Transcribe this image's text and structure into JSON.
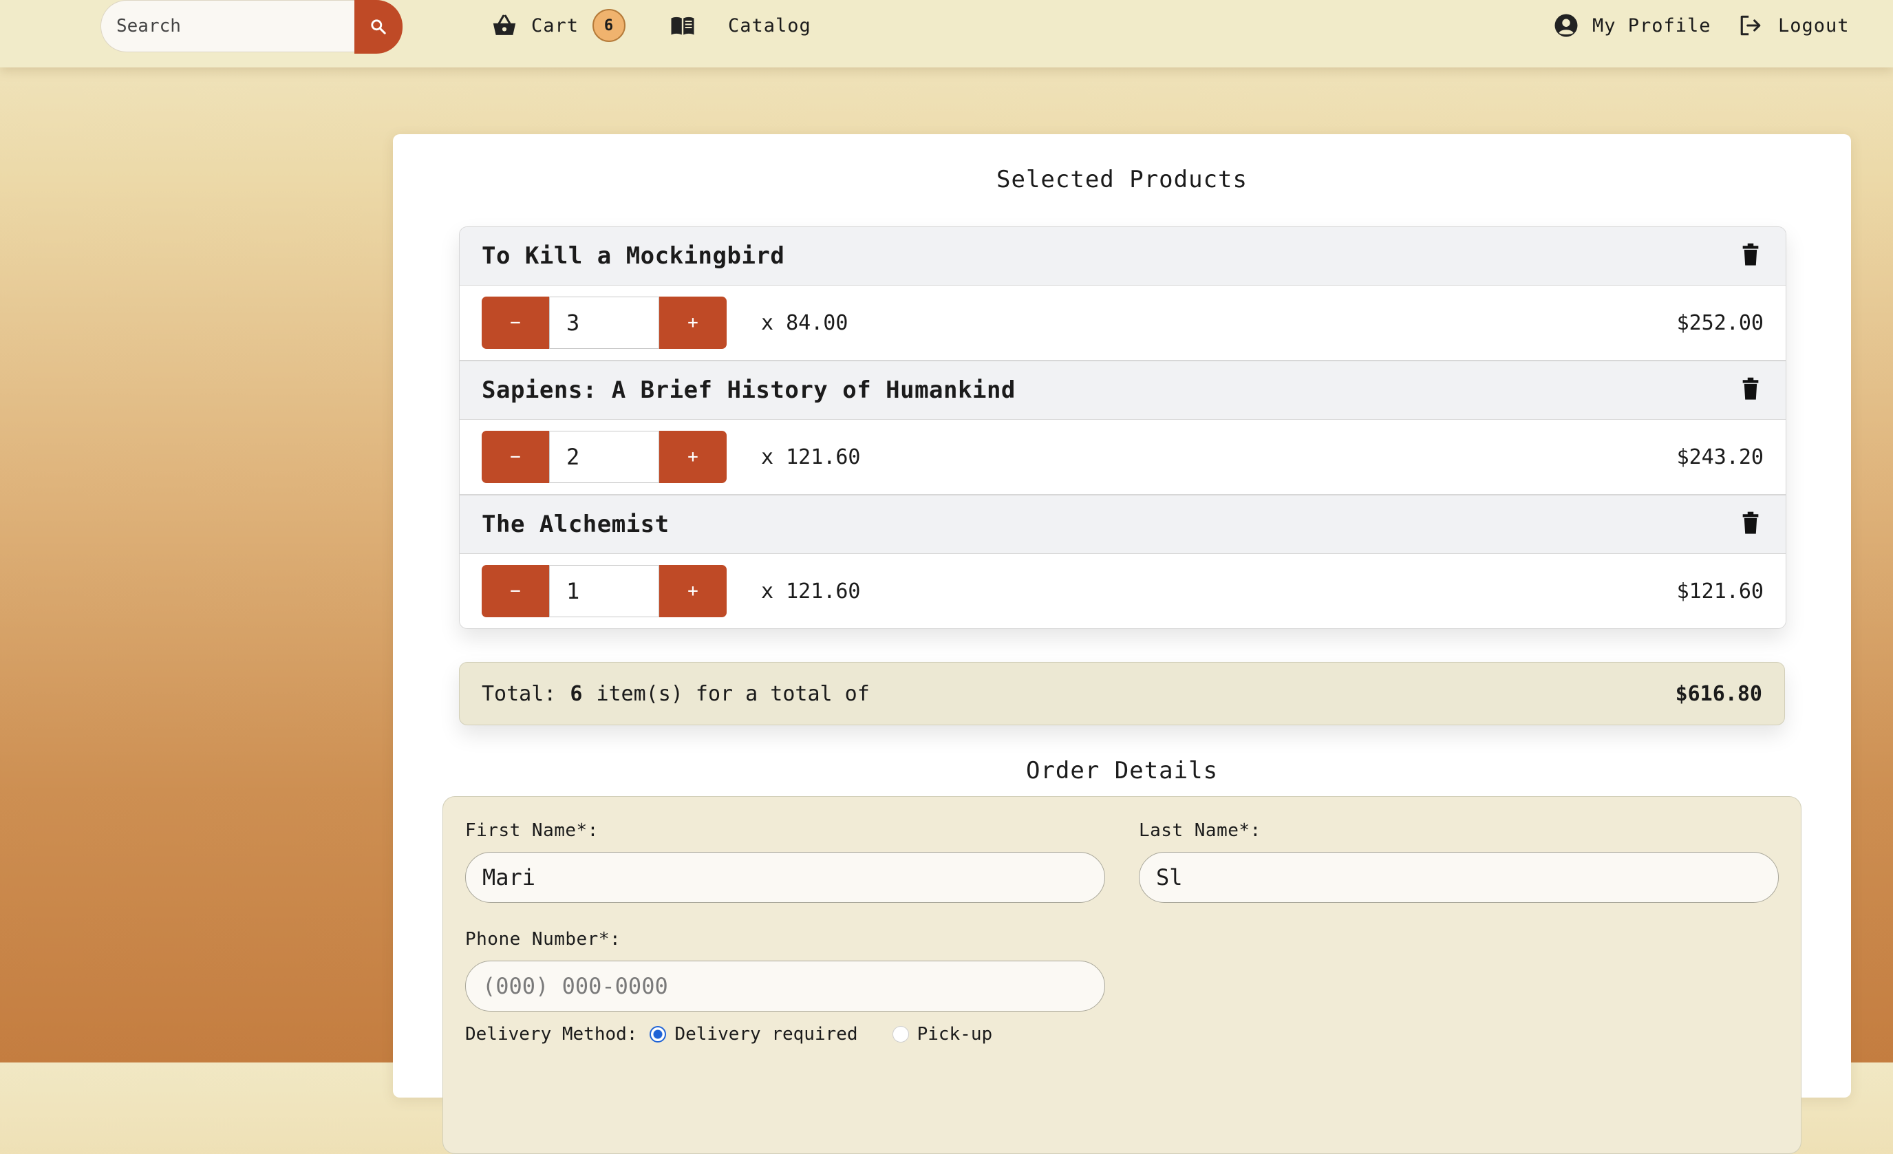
{
  "nav": {
    "search_placeholder": "Search",
    "cart_label": "Cart",
    "cart_count": "6",
    "catalog_label": "Catalog",
    "profile_label": "My Profile",
    "logout_label": "Logout"
  },
  "cart": {
    "title": "Selected Products",
    "items": [
      {
        "name": "To Kill a Mockingbird",
        "quantity": "3",
        "unit_price": "x 84.00",
        "line_total": "$252.00"
      },
      {
        "name": "Sapiens: A Brief History of Humankind",
        "quantity": "2",
        "unit_price": "x 121.60",
        "line_total": "$243.20"
      },
      {
        "name": "The Alchemist",
        "quantity": "1",
        "unit_price": "x 121.60",
        "line_total": "$121.60"
      }
    ],
    "minus_label": "−",
    "plus_label": "+",
    "total_prefix": "Total:",
    "total_count": "6",
    "total_suffix": "item(s) for a total of",
    "grand_total": "$616.80"
  },
  "order": {
    "title": "Order Details",
    "first_name_label": "First Name*:",
    "first_name_value": "Mari",
    "last_name_label": "Last Name*:",
    "last_name_value": "Sl",
    "phone_label": "Phone Number*:",
    "phone_placeholder": "(000) 000-0000",
    "phone_value": "",
    "delivery_label": "Delivery Method:",
    "delivery_options": [
      "Delivery required",
      "Pick-up"
    ],
    "delivery_selected": "Delivery required"
  },
  "colors": {
    "accent": "#bf4a26",
    "badge": "#f0b36e",
    "radio_selected": "#1f63d6"
  }
}
